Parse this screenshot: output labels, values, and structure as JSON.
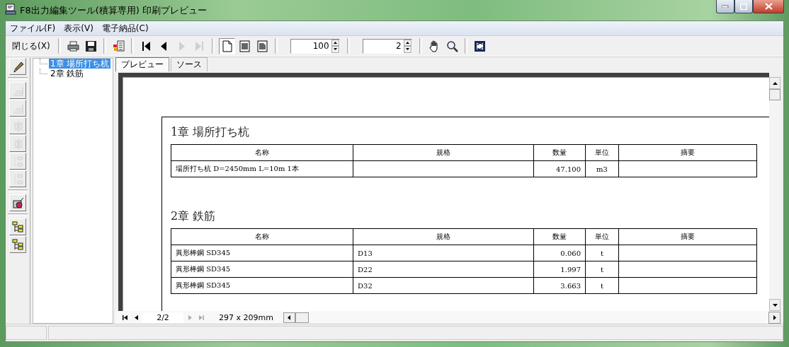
{
  "window": {
    "title": "F8出力編集ツール(積算専用) 印刷プレビュー"
  },
  "menu": [
    "ファイル(F)",
    "表示(V)",
    "電子納品(C)"
  ],
  "toolbar": [
    {
      "kind": "text",
      "label": "閉じる(X)",
      "disabled": false
    },
    {
      "kind": "sep"
    },
    {
      "kind": "print",
      "disabled": false
    },
    {
      "kind": "save",
      "disabled": false
    },
    {
      "kind": "sep"
    },
    {
      "kind": "export",
      "disabled": false
    },
    {
      "kind": "sep"
    },
    {
      "kind": "first",
      "disabled": false
    },
    {
      "kind": "prev",
      "disabled": false
    },
    {
      "kind": "next",
      "disabled": true
    },
    {
      "kind": "last",
      "disabled": true
    },
    {
      "kind": "sep"
    },
    {
      "kind": "page-single",
      "selected": true
    },
    {
      "kind": "page-double",
      "selected": false
    },
    {
      "kind": "page-multi",
      "selected": false
    },
    {
      "kind": "sep"
    },
    {
      "kind": "spinner",
      "value": "100"
    },
    {
      "kind": "sep"
    },
    {
      "kind": "spinner",
      "value": "2"
    },
    {
      "kind": "sep"
    },
    {
      "kind": "hand",
      "disabled": false
    },
    {
      "kind": "zoom",
      "disabled": false
    },
    {
      "kind": "sep"
    },
    {
      "kind": "refresh",
      "disabled": false
    }
  ],
  "side_tools": [
    {
      "kind": "pen",
      "disabled": false
    },
    {
      "kind": "sep"
    },
    {
      "kind": "steps",
      "disabled": true
    },
    {
      "kind": "steps",
      "disabled": true
    },
    {
      "kind": "web",
      "disabled": true
    },
    {
      "kind": "web",
      "disabled": true
    },
    {
      "kind": "nodes",
      "disabled": true
    },
    {
      "kind": "nodes",
      "disabled": true
    },
    {
      "kind": "sep"
    },
    {
      "kind": "number",
      "disabled": false
    },
    {
      "kind": "sep"
    },
    {
      "kind": "tree",
      "disabled": false
    },
    {
      "kind": "tree",
      "disabled": false
    }
  ],
  "tree": [
    {
      "label": "1章 場所打ち杭",
      "selected": true
    },
    {
      "label": "2章 鉄筋",
      "selected": false
    }
  ],
  "tabs": [
    {
      "label": "プレビュー",
      "selected": true
    },
    {
      "label": "ソース",
      "selected": false
    }
  ],
  "document": {
    "chapters": [
      {
        "title": "1章 場所打ち杭",
        "columns": [
          "名称",
          "規格",
          "数量",
          "単位",
          "摘要"
        ],
        "rows": [
          [
            "場所打ち杭 D=2450mm L=10m 1本",
            "",
            "47.100",
            "m3",
            ""
          ]
        ]
      },
      {
        "title": "2章 鉄筋",
        "columns": [
          "名称",
          "規格",
          "数量",
          "単位",
          "摘要"
        ],
        "rows": [
          [
            "異形棒鋼 SD345",
            "D13",
            "0.060",
            "t",
            ""
          ],
          [
            "異形棒鋼 SD345",
            "D22",
            "1.997",
            "t",
            ""
          ],
          [
            "異形棒鋼 SD345",
            "D32",
            "3.663",
            "t",
            ""
          ]
        ]
      }
    ]
  },
  "pager": {
    "first_disabled": false,
    "prev_disabled": false,
    "next_disabled": true,
    "last_disabled": true,
    "page": "2/2",
    "size": "297 x 209mm"
  }
}
